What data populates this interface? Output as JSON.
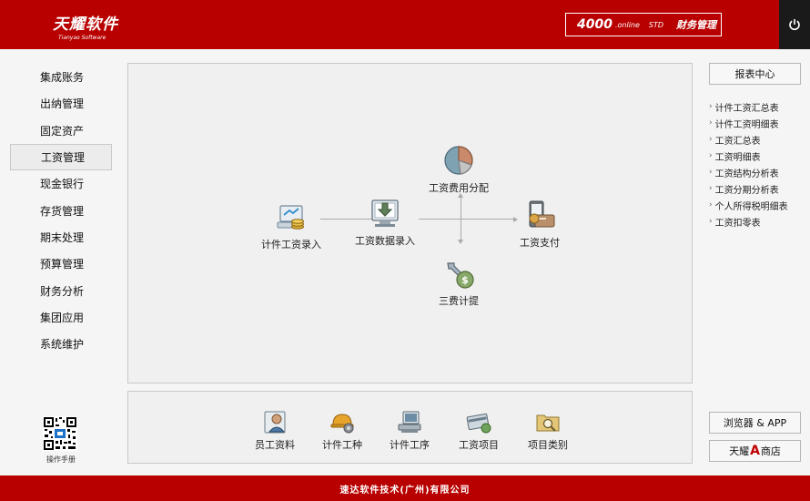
{
  "header": {
    "logo_cn": "天耀软件",
    "logo_en": "Tianyao Software",
    "product_num": "4000",
    "product_online": ".online",
    "product_std": "STD",
    "product_name": "财务管理"
  },
  "sidebar": {
    "items": [
      {
        "label": "集成账务"
      },
      {
        "label": "出纳管理"
      },
      {
        "label": "固定资产"
      },
      {
        "label": "工资管理"
      },
      {
        "label": "现金银行"
      },
      {
        "label": "存货管理"
      },
      {
        "label": "期末处理"
      },
      {
        "label": "预算管理"
      },
      {
        "label": "财务分析"
      },
      {
        "label": "集团应用"
      },
      {
        "label": "系统维护"
      }
    ],
    "active_index": 3,
    "qr_label": "操作手册"
  },
  "flow": {
    "piece_entry": "计件工资录入",
    "data_entry": "工资数据录入",
    "cost_alloc": "工资费用分配",
    "three_fees": "三费计提",
    "payment": "工资支付"
  },
  "bottom": {
    "items": [
      {
        "label": "员工资料",
        "icon": "employee-icon"
      },
      {
        "label": "计件工种",
        "icon": "worker-helmet-icon"
      },
      {
        "label": "计件工序",
        "icon": "process-computer-icon"
      },
      {
        "label": "工资项目",
        "icon": "salary-card-icon"
      },
      {
        "label": "项目类别",
        "icon": "folder-search-icon"
      }
    ]
  },
  "right": {
    "report_center": "报表中心",
    "reports": [
      {
        "label": "计件工资汇总表"
      },
      {
        "label": "计件工资明细表"
      },
      {
        "label": "工资汇总表"
      },
      {
        "label": "工资明细表"
      },
      {
        "label": "工资结构分析表"
      },
      {
        "label": "工资分期分析表"
      },
      {
        "label": "个人所得税明细表"
      },
      {
        "label": "工资扣零表"
      }
    ],
    "browser_app": "浏览器 & APP",
    "store_prefix": "天耀",
    "store_mark": "A",
    "store_suffix": "商店"
  },
  "footer": {
    "company": "速达软件技术(广州)有限公司"
  },
  "colors": {
    "brand_red": "#b80000",
    "power_bg": "#1a1a1a"
  }
}
